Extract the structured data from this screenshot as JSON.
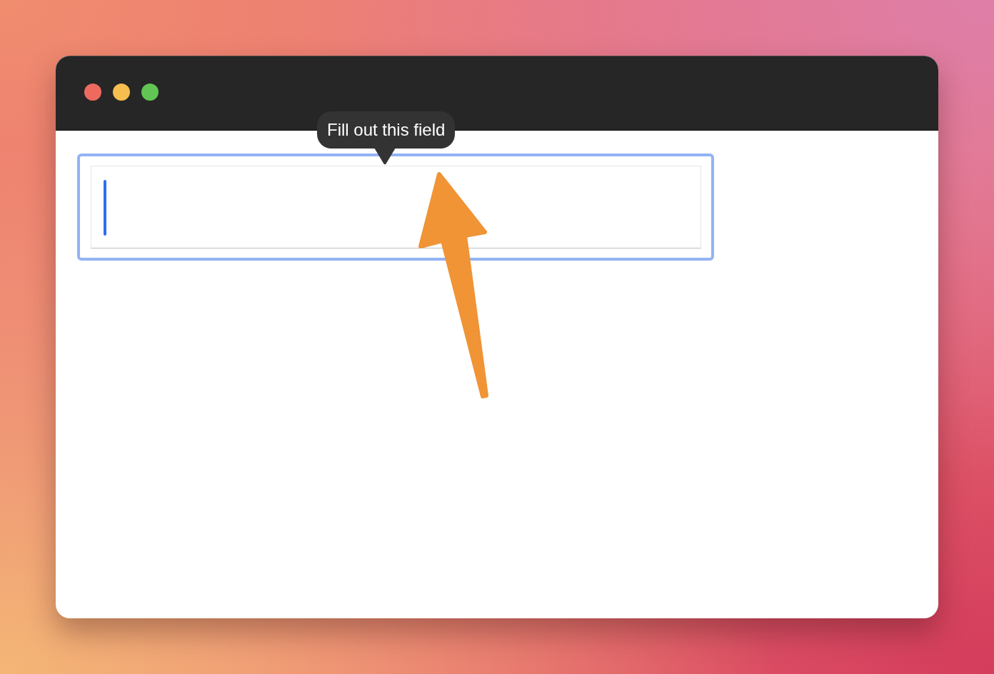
{
  "window": {
    "controls": [
      {
        "color": "#ee6a5f"
      },
      {
        "color": "#f5be4f"
      },
      {
        "color": "#61c554"
      }
    ]
  },
  "text_field": {
    "focused": true
  },
  "tooltip": {
    "text": "Fill out this field"
  }
}
